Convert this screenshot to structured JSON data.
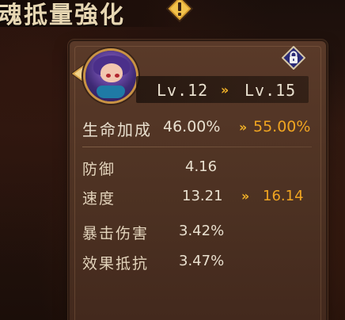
{
  "header": {
    "title": "魂抵量強化"
  },
  "card": {
    "level": {
      "from": "Lv.12",
      "arrow": "››",
      "to": "Lv.15"
    },
    "highlight": {
      "label": "生命加成",
      "old": "46.00%",
      "arrow": "››",
      "new": "55.00%"
    },
    "stats": [
      {
        "label": "防御",
        "old": "4.16"
      },
      {
        "label": "速度",
        "old": "13.21",
        "arrow": "››",
        "new": "16.14"
      },
      {
        "label": "暴击伤害",
        "old": "3.42%"
      },
      {
        "label": "效果抵抗",
        "old": "3.47%"
      }
    ]
  },
  "icons": {
    "warning": "warning-icon",
    "lock": "lock-icon",
    "character": "character-avatar"
  },
  "colors": {
    "accent": "#f0a521",
    "panel": "#4c3122",
    "text": "#e9e0cf"
  }
}
